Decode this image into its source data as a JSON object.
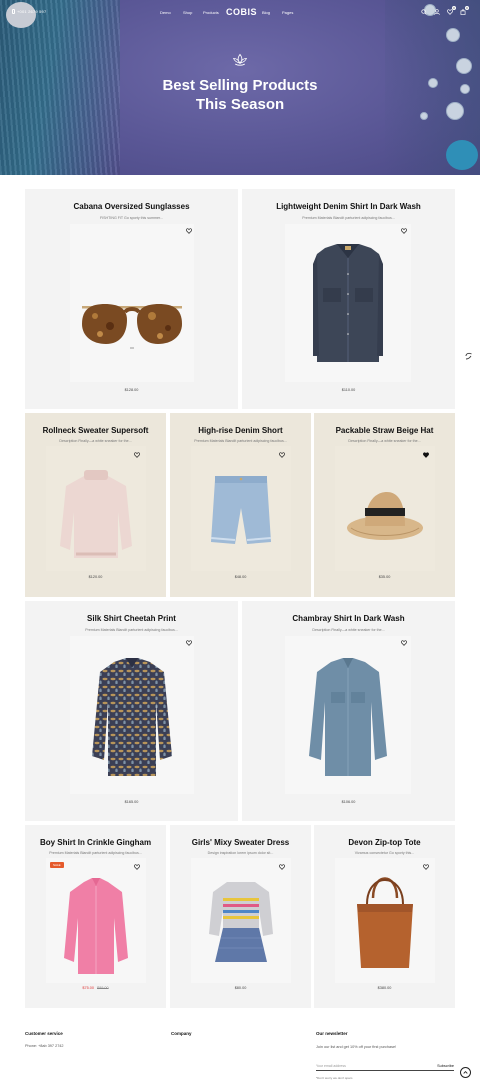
{
  "header": {
    "phone": "+001 2679 597",
    "logo": "COBIS",
    "nav": [
      "Demo",
      "Shop",
      "Products",
      "Blog",
      "Pages"
    ]
  },
  "icons": [
    "search-icon",
    "user-icon",
    "heart-icon",
    "cart-icon",
    "lotus-icon",
    "arrow-up-icon"
  ],
  "counts": {
    "wishlist": "0",
    "cart": "0"
  },
  "hero": {
    "title_line1": "Best Selling Products",
    "title_line2": "This Season"
  },
  "products": [
    {
      "title": "Cabana Oversized Sunglasses",
      "desc": "FISHTING FIT Go sporty this summer...",
      "price": "$128.00",
      "image": "sunglasses"
    },
    {
      "title": "Lightweight Denim Shirt In Dark Wash",
      "desc": "Premium Materials Blandit parturient adipiscing faucibus...",
      "price": "$110.00",
      "image": "denim-shirt"
    },
    {
      "title": "Rollneck Sweater Supersoft",
      "desc": "Description Finally—a white sneaker for the...",
      "price": "$120.00",
      "image": "sweater"
    },
    {
      "title": "High-rise Denim Short",
      "desc": "Premium Materials Blandit parturient adipiscing faucibus...",
      "price": "$48.00",
      "image": "denim-short"
    },
    {
      "title": "Packable Straw Beige Hat",
      "desc": "Description Finally—a white sneaker for the...",
      "price": "$35.00",
      "image": "straw-hat"
    },
    {
      "title": "Silk Shirt Cheetah Print",
      "desc": "Premium Materials Blandit parturient adipiscing faucibus...",
      "price": "$165.00",
      "image": "print-shirt"
    },
    {
      "title": "Chambray Shirt In Dark Wash",
      "desc": "Description Finally—a white sneaker for the...",
      "price": "$106.00",
      "image": "chambray-shirt"
    },
    {
      "title": "Boy Shirt In Crinkle Gingham",
      "desc": "Premium Materials Blandit parturient adipiscing faucibus...",
      "price": "$75.00",
      "old_price": "$89.00",
      "badge": "SALE",
      "image": "pink-shirt"
    },
    {
      "title": "Girls' Mixy Sweater Dress",
      "desc": "Design inspiration lorem ipsum dolor sit...",
      "price": "$80.00",
      "image": "sweater-dress"
    },
    {
      "title": "Devon Zip-top Tote",
      "desc": "Vivamus consectetur Go sporty this...",
      "price": "$380.00",
      "image": "tote-bag"
    }
  ],
  "footer": {
    "customer_service": "Customer service",
    "phone_line": "Phone: +8ab 397 2742",
    "company": "Company",
    "newsletter": "Our newsletter",
    "newsletter_text": "Join our list and get 10% off your first purchase!",
    "email_placeholder": "Your email address",
    "subscribe": "Subscribe",
    "note": "*Don't worry we don't spam"
  },
  "colors": {
    "hero": "#5a5796",
    "card": "#f3f3f3",
    "card_beige": "#ece7db",
    "sale": "#e55a2b",
    "sale_price": "#dd3333"
  }
}
